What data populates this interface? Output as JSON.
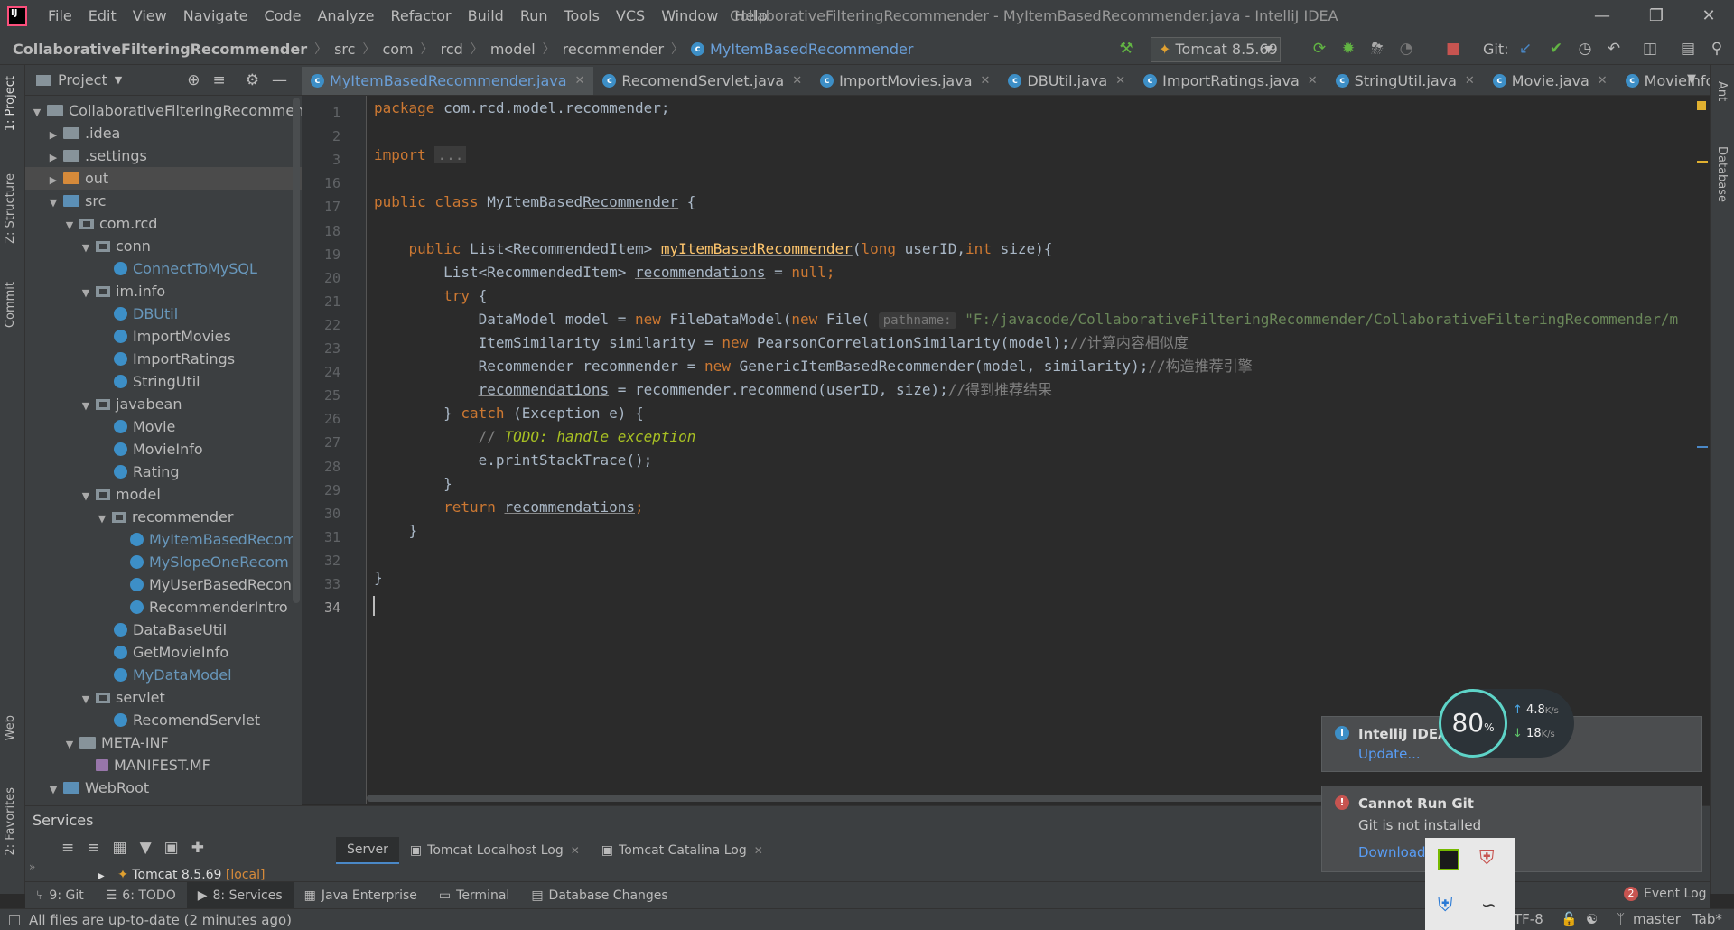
{
  "menubar": {
    "items": [
      "File",
      "Edit",
      "View",
      "Navigate",
      "Code",
      "Analyze",
      "Refactor",
      "Build",
      "Run",
      "Tools",
      "VCS",
      "Window",
      "Help"
    ],
    "title": "CollaborativeFilteringRecommender - MyItemBasedRecommender.java - IntelliJ IDEA"
  },
  "navbar": {
    "crumbs": [
      "CollaborativeFilteringRecommender",
      "src",
      "com",
      "rcd",
      "model",
      "recommender",
      "MyItemBasedRecommender"
    ],
    "run_config": "Tomcat 8.5.69",
    "git_label": "Git:"
  },
  "left_stripe": {
    "project": "1: Project",
    "structure": "Z: Structure",
    "commit": "Commit",
    "web": "Web",
    "favorites": "2: Favorites"
  },
  "right_stripe": {
    "ant": "Ant",
    "database": "Database"
  },
  "project_panel": {
    "title": "Project",
    "tree": [
      {
        "label": "CollaborativeFilteringRecommende",
        "depth": 0,
        "arrow": "▼",
        "icon": "folder"
      },
      {
        "label": ".idea",
        "depth": 1,
        "arrow": "▶",
        "icon": "folder"
      },
      {
        "label": ".settings",
        "depth": 1,
        "arrow": "▶",
        "icon": "folder"
      },
      {
        "label": "out",
        "depth": 1,
        "arrow": "▶",
        "icon": "folder-orange",
        "selected": true
      },
      {
        "label": "src",
        "depth": 1,
        "arrow": "▼",
        "icon": "folder-blue"
      },
      {
        "label": "com.rcd",
        "depth": 2,
        "arrow": "▼",
        "icon": "package"
      },
      {
        "label": "conn",
        "depth": 3,
        "arrow": "▼",
        "icon": "package"
      },
      {
        "label": "ConnectToMySQL",
        "depth": 4,
        "arrow": "",
        "icon": "class",
        "color": "blue"
      },
      {
        "label": "im.info",
        "depth": 3,
        "arrow": "▼",
        "icon": "package"
      },
      {
        "label": "DBUtil",
        "depth": 4,
        "arrow": "",
        "icon": "class",
        "color": "blue"
      },
      {
        "label": "ImportMovies",
        "depth": 4,
        "arrow": "",
        "icon": "class"
      },
      {
        "label": "ImportRatings",
        "depth": 4,
        "arrow": "",
        "icon": "class"
      },
      {
        "label": "StringUtil",
        "depth": 4,
        "arrow": "",
        "icon": "class"
      },
      {
        "label": "javabean",
        "depth": 3,
        "arrow": "▼",
        "icon": "package"
      },
      {
        "label": "Movie",
        "depth": 4,
        "arrow": "",
        "icon": "class"
      },
      {
        "label": "MovieInfo",
        "depth": 4,
        "arrow": "",
        "icon": "class"
      },
      {
        "label": "Rating",
        "depth": 4,
        "arrow": "",
        "icon": "class"
      },
      {
        "label": "model",
        "depth": 3,
        "arrow": "▼",
        "icon": "package"
      },
      {
        "label": "recommender",
        "depth": 4,
        "arrow": "▼",
        "icon": "package"
      },
      {
        "label": "MyItemBasedRecom",
        "depth": 5,
        "arrow": "",
        "icon": "class",
        "color": "blue"
      },
      {
        "label": "MySlopeOneRecom",
        "depth": 5,
        "arrow": "",
        "icon": "class",
        "color": "blue"
      },
      {
        "label": "MyUserBasedRecon",
        "depth": 5,
        "arrow": "",
        "icon": "class"
      },
      {
        "label": "RecommenderIntro",
        "depth": 5,
        "arrow": "",
        "icon": "class"
      },
      {
        "label": "DataBaseUtil",
        "depth": 4,
        "arrow": "",
        "icon": "class"
      },
      {
        "label": "GetMovieInfo",
        "depth": 4,
        "arrow": "",
        "icon": "class"
      },
      {
        "label": "MyDataModel",
        "depth": 4,
        "arrow": "",
        "icon": "class",
        "color": "blue"
      },
      {
        "label": "servlet",
        "depth": 3,
        "arrow": "▼",
        "icon": "package"
      },
      {
        "label": "RecomendServlet",
        "depth": 4,
        "arrow": "",
        "icon": "class"
      },
      {
        "label": "META-INF",
        "depth": 2,
        "arrow": "▼",
        "icon": "folder"
      },
      {
        "label": "MANIFEST.MF",
        "depth": 3,
        "arrow": "",
        "icon": "mf"
      },
      {
        "label": "WebRoot",
        "depth": 1,
        "arrow": "▼",
        "icon": "folder-blue"
      }
    ]
  },
  "tabs": [
    {
      "label": "MyItemBasedRecommender.java",
      "active": true
    },
    {
      "label": "RecomendServlet.java"
    },
    {
      "label": "ImportMovies.java"
    },
    {
      "label": "DBUtil.java"
    },
    {
      "label": "ImportRatings.java"
    },
    {
      "label": "StringUtil.java"
    },
    {
      "label": "Movie.java"
    },
    {
      "label": "MovieInfo.java"
    }
  ],
  "editor": {
    "line_numbers": [
      "1",
      "2",
      "3",
      "16",
      "17",
      "18",
      "19",
      "20",
      "21",
      "22",
      "23",
      "24",
      "25",
      "26",
      "27",
      "28",
      "29",
      "30",
      "31",
      "32",
      "33",
      "34"
    ],
    "code": {
      "l1_kw": "package",
      "l1_rest": " com.rcd.model.recommender;",
      "l3_kw": "import",
      "l3_fold": "...",
      "l17_kw": "public class",
      "l17_a": " MyItemBased",
      "l17_b": "Recommender",
      "l17_c": " {",
      "l19_kw": "public",
      "l19_a": " List<RecommendedItem> ",
      "l19_fn": "myItemBasedRecommender",
      "l19_b": "(",
      "l19_kw2": "long",
      "l19_c": " userID,",
      "l19_kw3": "int",
      "l19_d": " size){",
      "l20_a": "List<RecommendedItem> ",
      "l20_b": "recommendations",
      "l20_c": " = ",
      "l20_kw": "null",
      "l20_d": ";",
      "l21_kw": "try",
      "l21_a": " {",
      "l22_a": "DataModel model = ",
      "l22_kw": "new",
      "l22_b": " FileDataModel(",
      "l22_kw2": "new",
      "l22_c": " File( ",
      "l22_hint": "pathname:",
      "l22_str": " \"F:/javacode/CollaborativeFilteringRecommender/CollaborativeFilteringRecommender/m",
      "l23_a": "ItemSimilarity similarity = ",
      "l23_kw": "new",
      "l23_b": " PearsonCorrelationSimilarity(model);",
      "l23_cm": "//计算内容相似度",
      "l24_a": "Recommender recommender = ",
      "l24_kw": "new",
      "l24_b": " GenericItemBasedRecommender(model, similarity);",
      "l24_cm": "//构造推荐引擎",
      "l25_a": "recommendations",
      "l25_b": " = recommender.recommend(userID, size);",
      "l25_cm": "//得到推荐结果",
      "l26_a": "} ",
      "l26_kw": "catch",
      "l26_b": " (Exception e) {",
      "l27_cm": "// ",
      "l27_todo": "TODO: handle exception",
      "l28_a": "e.printStackTrace();",
      "l29_a": "}",
      "l30_kw": "return",
      "l30_a": " ",
      "l30_b": "recommendations",
      "l30_c": ";",
      "l31_a": "}",
      "l33_a": "}"
    }
  },
  "services": {
    "title": "Services",
    "tabs": [
      "Server",
      "Tomcat Localhost Log",
      "Tomcat Catalina Log"
    ],
    "tree_item": "Tomcat 8.5.69",
    "tree_item_suffix": "[local]"
  },
  "bottom_tabs": [
    {
      "label": "9: Git"
    },
    {
      "label": "6: TODO"
    },
    {
      "label": "8: Services",
      "active": true
    },
    {
      "label": "Java Enterprise"
    },
    {
      "label": "Terminal"
    },
    {
      "label": "Database Changes"
    }
  ],
  "event_log": {
    "count": "2",
    "label": "Event Log"
  },
  "statusbar": {
    "message": "All files are up-to-date (2 minutes ago)",
    "encoding": "TF-8",
    "branch": "master",
    "indent": "Tab*"
  },
  "notifications": [
    {
      "title": "IntelliJ IDEA",
      "link": "Update..."
    },
    {
      "title": "Cannot Run Git",
      "body": "Git is not installed",
      "link": "Download"
    }
  ],
  "net_widget": {
    "percent": "80",
    "percent_unit": "%",
    "upload": "4.8",
    "upload_unit": "K/s",
    "download": "18",
    "download_unit": "K/s"
  },
  "colors": {
    "accent": "#4a88c7",
    "keyword": "#cc7832",
    "function": "#ffc66d",
    "string": "#6a8759",
    "error": "#c75450"
  }
}
